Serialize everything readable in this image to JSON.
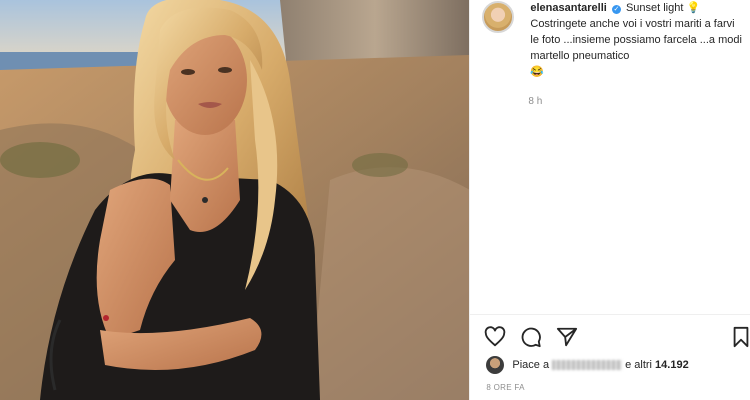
{
  "post": {
    "username": "elenasantarelli",
    "caption_title": "Sunset light",
    "caption_body": "Costringete anche voi i vostri mariti a farvi le foto ...insieme possiamo farcela ...a modi martello pneumatico",
    "caption_emoji": "😂",
    "title_emoji": "💡",
    "relative_time": "8 h",
    "likes_prefix": "Piace a",
    "likes_suffix": "e altri",
    "likes_count": "14.192",
    "date_label": "8 ORE FA"
  },
  "icons": {
    "like": "heart-icon",
    "comment": "comment-icon",
    "share": "paper-plane-icon",
    "save": "bookmark-icon",
    "verified": "verified-badge-icon"
  },
  "colors": {
    "text": "#262626",
    "muted": "#8e8e8e",
    "verified": "#3897f0",
    "border": "#efefef"
  }
}
